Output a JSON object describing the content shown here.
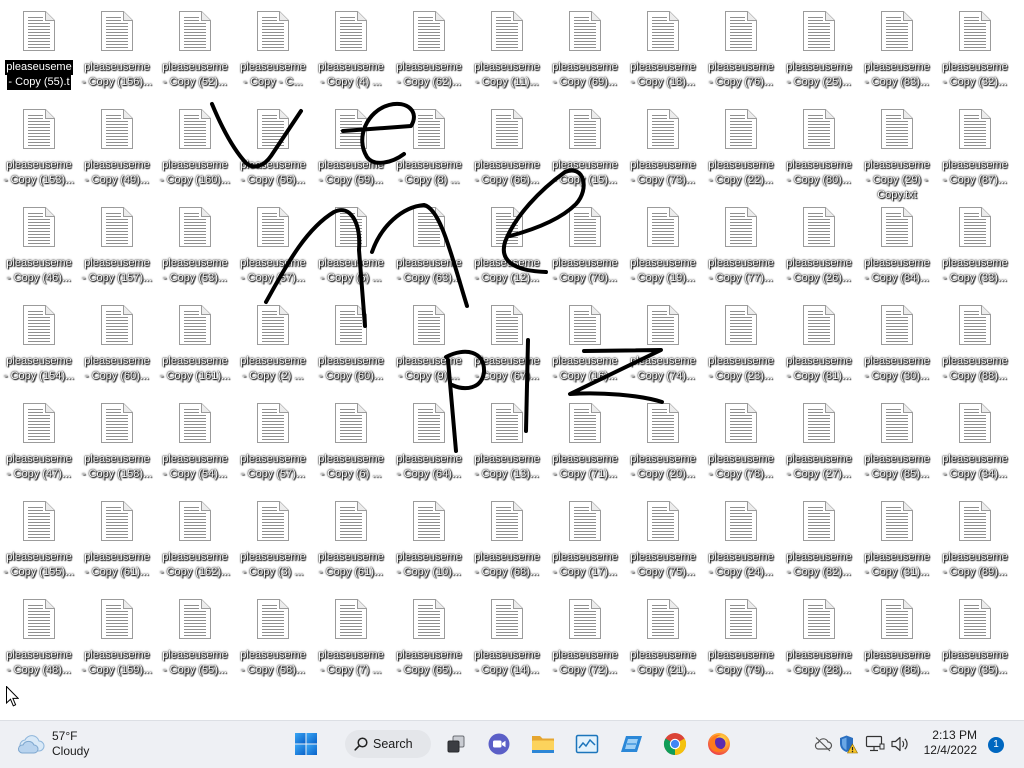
{
  "desktop": {
    "icon_type": "text-document-icon",
    "label_line1": "pleaseuseme",
    "scribble_text": "Use me plz",
    "icon_rows": [
      [
        {
          "line2": "- Copy (55).t",
          "selected": true
        },
        "- Copy (156)...",
        "- Copy (52)...",
        "- Copy - C...",
        "- Copy (4) ...",
        "- Copy (62)...",
        "- Copy (11)...",
        "- Copy (69)...",
        "- Copy (18)...",
        "- Copy (76)...",
        "- Copy (25)...",
        "- Copy (83)...",
        "- Copy (32)..."
      ],
      [
        "- Copy (153)...",
        "- Copy (49)...",
        "- Copy (160)...",
        "- Copy (56)...",
        "- Copy (59)...",
        "- Copy (8) ...",
        "- Copy (66)...",
        "- Copy (15)...",
        "- Copy (73)...",
        "- Copy (22)...",
        "- Copy (80)...",
        {
          "line2": "- Copy (29) -",
          "line3": "Copy.txt"
        },
        "- Copy (87)..."
      ],
      [
        "- Copy (46)...",
        "- Copy (157)...",
        "- Copy (53)...",
        "- Copy (57)...",
        "- Copy (5) ...",
        "- Copy (63)...",
        "- Copy (12)...",
        "- Copy (70)...",
        "- Copy (19)...",
        "- Copy (77)...",
        "- Copy (26)...",
        "- Copy (84)...",
        "- Copy (33)..."
      ],
      [
        "- Copy (154)...",
        "- Copy (60)...",
        "- Copy (161)...",
        "- Copy (2) ...",
        "- Copy (60)...",
        "- Copy (9) ...",
        "- Copy (67)...",
        "- Copy (16)...",
        "- Copy (74)...",
        "- Copy (23)...",
        "- Copy (81)...",
        "- Copy (30)...",
        "- Copy (88)..."
      ],
      [
        "- Copy (47)...",
        "- Copy (158)...",
        "- Copy (54)...",
        "- Copy (57)...",
        "- Copy (6) ...",
        "- Copy (64)...",
        "- Copy (13)...",
        "- Copy (71)...",
        "- Copy (20)...",
        "- Copy (78)...",
        "- Copy (27)...",
        "- Copy (85)...",
        "- Copy (34)..."
      ],
      [
        "- Copy (155)...",
        "- Copy (61)...",
        "- Copy (162)...",
        "- Copy (3) ...",
        "- Copy (61)...",
        "- Copy (10)...",
        "- Copy (68)...",
        "- Copy (17)...",
        "- Copy (75)...",
        "- Copy (24)...",
        "- Copy (82)...",
        "- Copy (31)...",
        "- Copy (89)..."
      ],
      [
        "- Copy (48)...",
        "- Copy (159)...",
        "- Copy (55)...",
        "- Copy (58)...",
        "- Copy (7) ...",
        "- Copy (65)...",
        "- Copy (14)...",
        "- Copy (72)...",
        "- Copy (21)...",
        "- Copy (79)...",
        "- Copy (28)...",
        "- Copy (86)...",
        "- Copy (35)..."
      ]
    ]
  },
  "taskbar": {
    "weather": {
      "icon": "cloudy-weather-icon",
      "temperature": "57°F",
      "condition": "Cloudy"
    },
    "start": {
      "icon": "windows-start-icon"
    },
    "search": {
      "icon": "search-icon",
      "label": "Search"
    },
    "apps": [
      "task-view-icon",
      "chat-icon",
      "file-explorer-icon",
      "photos-icon",
      "blue-app-icon",
      "chrome-icon",
      "firefox-icon"
    ],
    "tray": {
      "icons": [
        "onedrive-offline-icon",
        "windows-security-warning-icon",
        "network-icon",
        "volume-icon"
      ],
      "time": "2:13 PM",
      "date": "12/4/2022",
      "notification_count": "1"
    }
  },
  "colors": {
    "desktop_bg": "#ffffff",
    "ink": "#000000",
    "taskbar_bg": "#eef0f4",
    "accent": "#0067c0",
    "selection_bg": "#000000"
  }
}
